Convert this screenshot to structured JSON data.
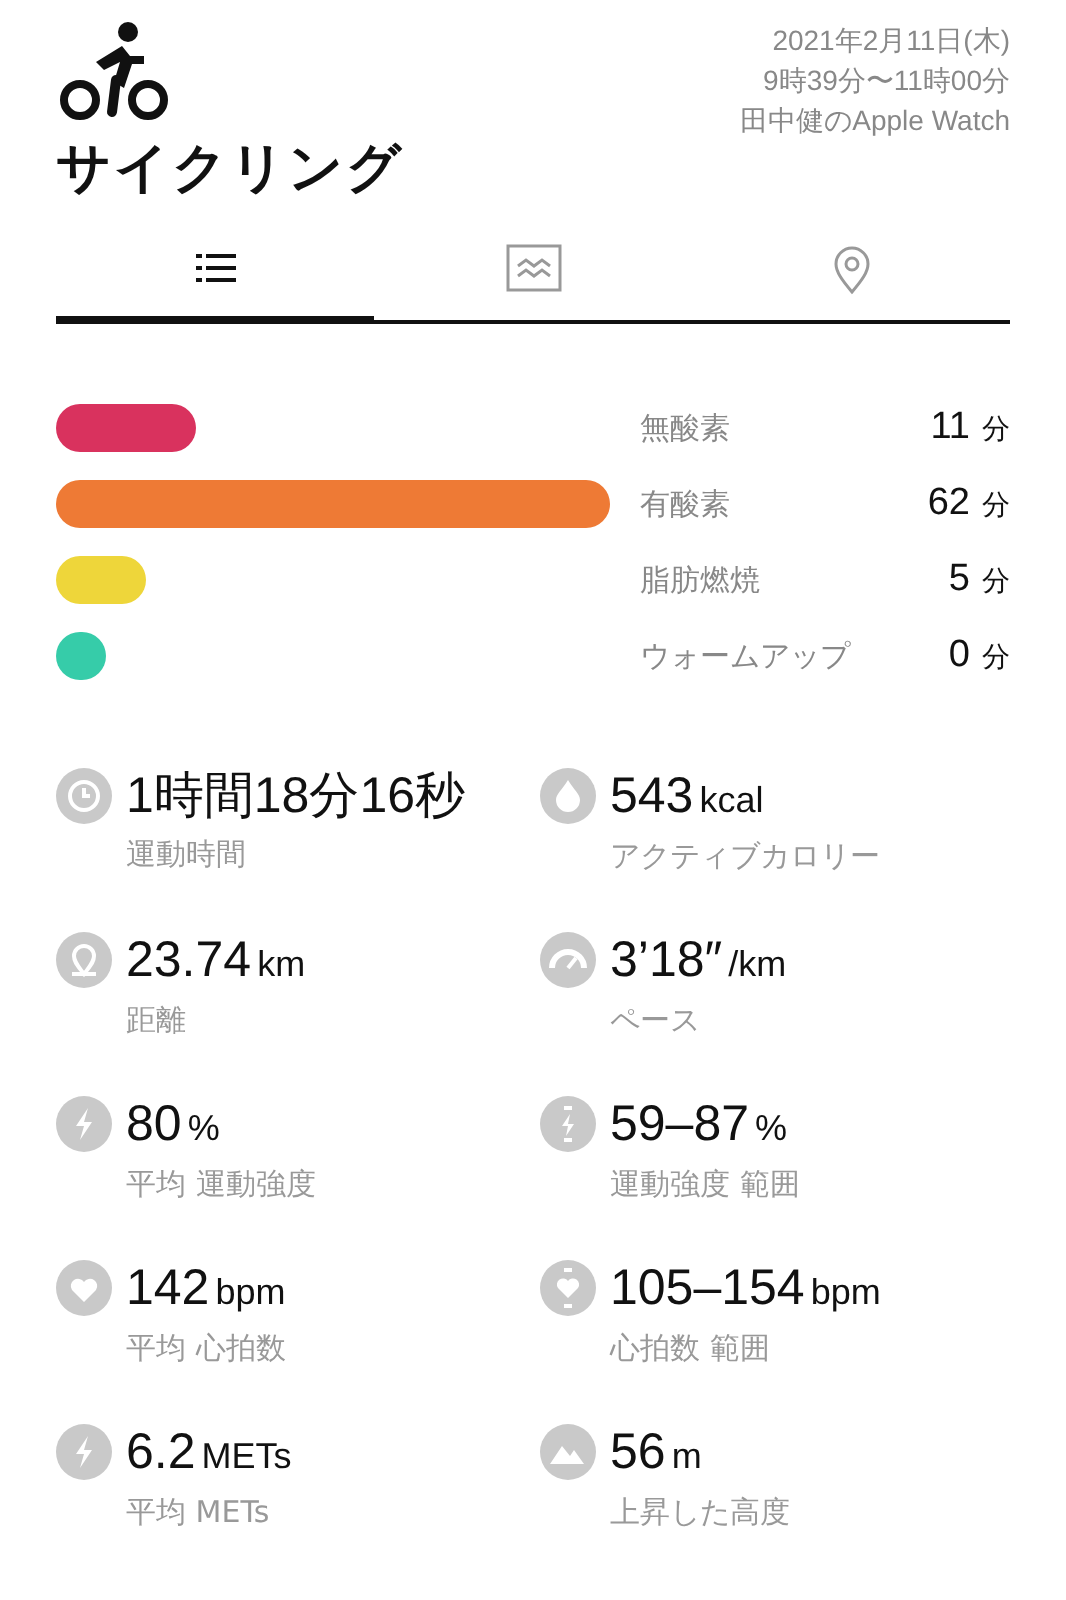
{
  "header": {
    "title": "サイクリング",
    "date": "2021年2月11日(木)",
    "time": "9時39分〜11時00分",
    "device": "田中健のApple Watch"
  },
  "tabs": [
    {
      "kind": "list",
      "selected": true
    },
    {
      "kind": "chart",
      "selected": false
    },
    {
      "kind": "map",
      "selected": false
    }
  ],
  "zones": [
    {
      "label": "無酸素",
      "value": "11",
      "unit": "分",
      "color": "#d9325e"
    },
    {
      "label": "有酸素",
      "value": "62",
      "unit": "分",
      "color": "#ee7a35"
    },
    {
      "label": "脂肪燃焼",
      "value": "5",
      "unit": "分",
      "color": "#eed63a"
    },
    {
      "label": "ウォームアップ",
      "value": "0",
      "unit": "分",
      "color": "#36cca9"
    }
  ],
  "metrics": [
    {
      "kind": "clock",
      "value": "1時間18分16秒",
      "label": "運動時間"
    },
    {
      "kind": "drop",
      "value": "543",
      "unit": "kcal",
      "label": "アクティブカロリー"
    },
    {
      "kind": "pin",
      "value": "23.74",
      "unit": "km",
      "label": "距離"
    },
    {
      "kind": "gauge",
      "value": "3’18″",
      "unit": "/km",
      "label": "ペース"
    },
    {
      "kind": "bolt",
      "value": "80",
      "unit": "%",
      "label": "平均 運動強度"
    },
    {
      "kind": "boltrange",
      "value": "59–87",
      "unit": "%",
      "label": "運動強度 範囲"
    },
    {
      "kind": "heart",
      "value": "142",
      "unit": "bpm",
      "label": "平均 心拍数"
    },
    {
      "kind": "heartrange",
      "value": "105–154",
      "unit": "bpm",
      "label": "心拍数 範囲"
    },
    {
      "kind": "bolt",
      "value": "6.2",
      "unit": "METs",
      "label": "平均 METs"
    },
    {
      "kind": "mountain",
      "value": "56",
      "unit": "m",
      "label": "上昇した高度"
    }
  ]
}
